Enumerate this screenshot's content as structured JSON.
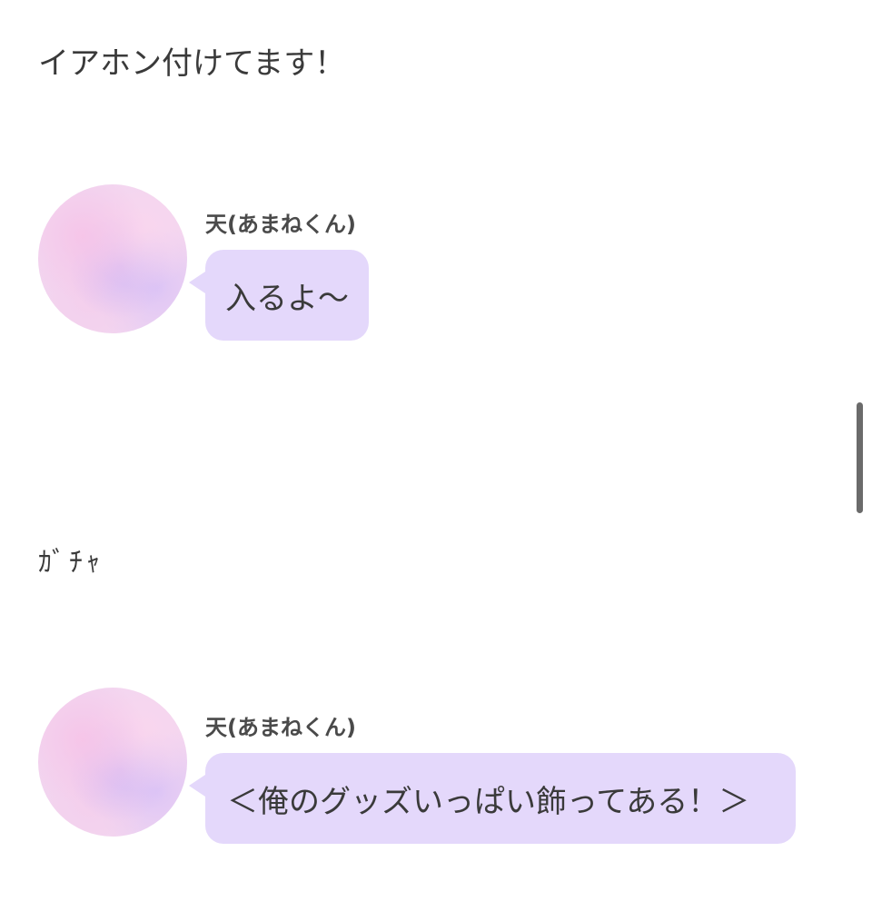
{
  "story": {
    "narration_1": "イアホン付けてます！",
    "narration_2": "ｶﾞﾁｬ",
    "messages": [
      {
        "speaker": "天(あまねくん)",
        "text": "入るよ〜"
      },
      {
        "speaker": "天(あまねくん)",
        "text": "＜俺のグッズいっぱい飾ってある！＞"
      }
    ]
  },
  "colors": {
    "bubble": "#e4d8fb",
    "text": "#3a3a3a",
    "scrollbar": "#6b6b6b"
  }
}
